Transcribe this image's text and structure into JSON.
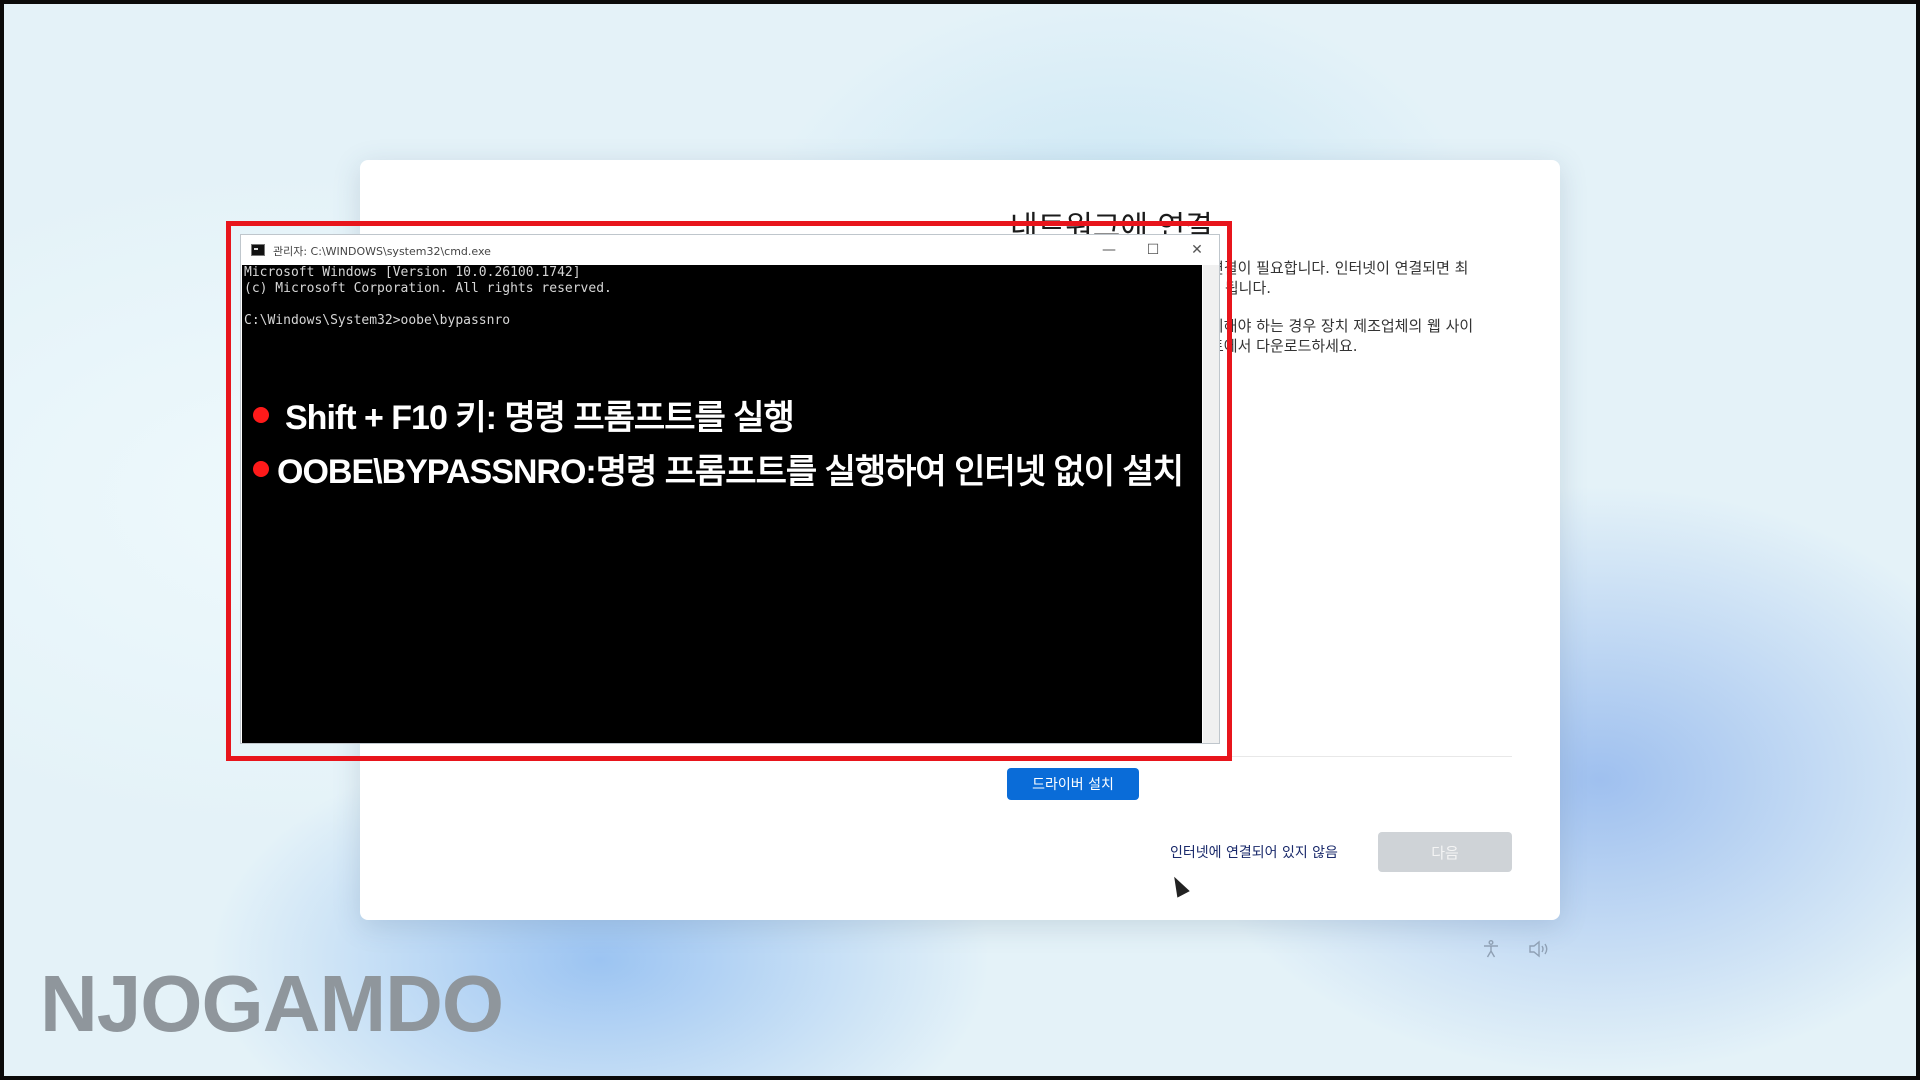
{
  "oobe": {
    "title": "네트워크에 연결",
    "desc_1_line_1": "연결이 필요합니다. 인터넷이 연결되면 최",
    "desc_1_line_2": "|| 됩니다.",
    "desc_2_line_1": "치해야 하는 경우 장치 제조업체의 웹 사이",
    "desc_2_line_2": "트에서 다운로드하세요.",
    "driver_button": "드라이버 설치",
    "no_internet_link": "인터넷에 연결되어 있지 않음",
    "next_button": "다음"
  },
  "cmd": {
    "title": "관리자: C:\\WINDOWS\\system32\\cmd.exe",
    "controls": {
      "minimize": "—",
      "maximize": "☐",
      "close": "✕"
    },
    "lines": [
      "Microsoft Windows [Version 10.0.26100.1742]",
      "(c) Microsoft Corporation. All rights reserved.",
      "",
      "C:\\Windows\\System32>oobe\\bypassnro"
    ]
  },
  "annotations": {
    "bullet_1": "Shift + F10 키: 명령 프롬프트를 실행",
    "bullet_2": "OOBE\\BYPASSNRO:명령 프롬프트를 실행하여 인터넷 없이 설치",
    "highlight_color": "#e8151c"
  },
  "tray": {
    "accessibility_icon": "accessibility-icon",
    "volume_icon": "volume-icon"
  },
  "watermark": "NJOGAMDO",
  "colors": {
    "accent": "#0a6cd8",
    "disabled_button": "#cfd3d7",
    "terminal_bg": "#000000"
  }
}
